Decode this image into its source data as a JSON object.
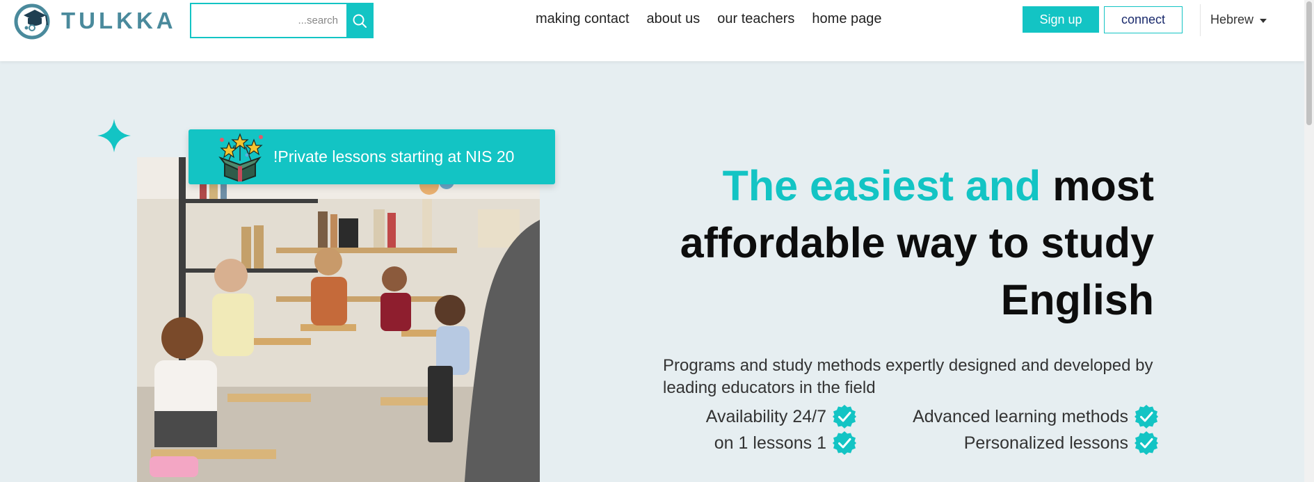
{
  "header": {
    "brand": "TULKKA",
    "search": {
      "placeholder": "...search",
      "value": ""
    },
    "nav": [
      {
        "label": "making contact"
      },
      {
        "label": "about us"
      },
      {
        "label": "our teachers"
      },
      {
        "label": "home page"
      }
    ],
    "signup_label": "Sign up",
    "connect_label": "connect",
    "language": "Hebrew"
  },
  "hero": {
    "promo_text": "!Private lessons starting at NIS 20",
    "headline_accent": "The easiest and",
    "headline_rest": "most affordable way to study English",
    "subtext": "Programs and study methods expertly designed and developed by leading educators in the field",
    "features": [
      {
        "label": "Availability 24/7"
      },
      {
        "label": "on 1 lessons 1"
      },
      {
        "label": "Advanced learning methods"
      },
      {
        "label": "Personalized lessons"
      }
    ]
  },
  "colors": {
    "accent": "#13c4c4",
    "hero_bg": "#e6eef1",
    "logo": "#4a8a9c",
    "text_dark": "#0d0d0d"
  },
  "icons": [
    "logo-mark-icon",
    "search-icon",
    "chevron-down-icon",
    "sparkle-icon",
    "gift-box-icon",
    "check-badge-icon"
  ]
}
